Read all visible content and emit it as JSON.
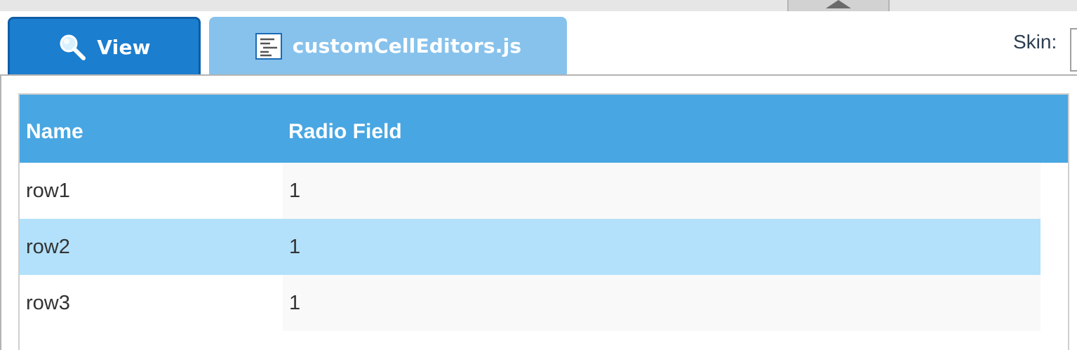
{
  "tabs": [
    {
      "label": "View",
      "icon": "magnifier-icon",
      "active": true
    },
    {
      "label": "customCellEditors.js",
      "icon": "source-file-icon",
      "active": false
    }
  ],
  "skin": {
    "label": "Skin:"
  },
  "grid": {
    "columns": [
      "Name",
      "Radio Field"
    ],
    "rows": [
      {
        "name": "row1",
        "radio": "1",
        "selected": false
      },
      {
        "name": "row2",
        "radio": "1",
        "selected": true
      },
      {
        "name": "row3",
        "radio": "1",
        "selected": false
      }
    ]
  },
  "colors": {
    "active_tab": "#1b7ecf",
    "inactive_tab": "#87c2ec",
    "header": "#48a6e2",
    "selected_row": "#b3e1fb"
  }
}
